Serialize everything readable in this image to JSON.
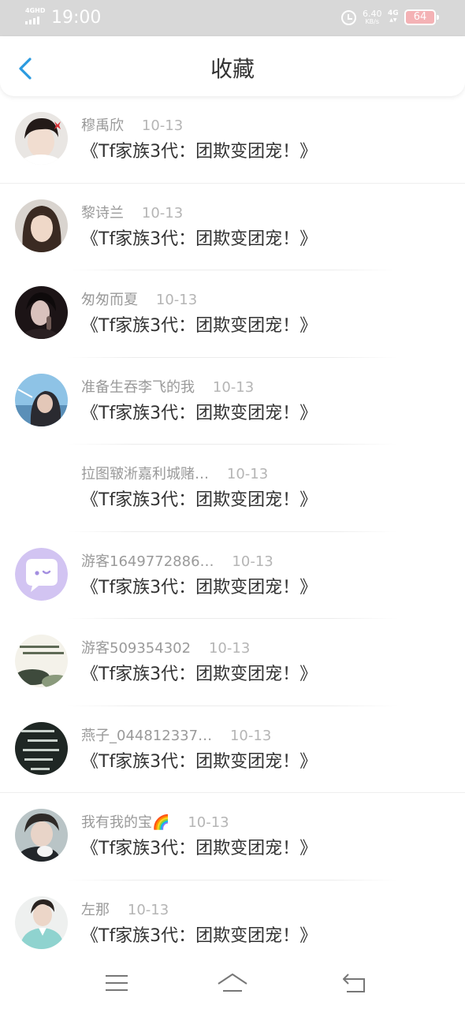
{
  "status_bar": {
    "network": "4GHD",
    "time": "19:00",
    "speed_value": "6.40",
    "speed_unit": "KB/s",
    "mobile_data": "4G",
    "battery": "64"
  },
  "header": {
    "title": "收藏",
    "back_icon": "chevron-left-icon",
    "accent_color": "#2a9ae0"
  },
  "items": [
    {
      "name": "穆禹欣",
      "date": "10-13",
      "title": "《Tf家族3代：团欺变团宠！》"
    },
    {
      "name": "黎诗兰",
      "date": "10-13",
      "title": "《Tf家族3代：团欺变团宠！》"
    },
    {
      "name": "匆匆而夏",
      "date": "10-13",
      "title": "《Tf家族3代：团欺变团宠！》"
    },
    {
      "name": "准备生吞李飞的我",
      "date": "10-13",
      "title": "《Tf家族3代：团欺变团宠！》"
    },
    {
      "name": "拉图皲淅嘉利城赌…",
      "date": "10-13",
      "title": "《Tf家族3代：团欺变团宠！》"
    },
    {
      "name": "游客1649772886…",
      "date": "10-13",
      "title": "《Tf家族3代：团欺变团宠！》"
    },
    {
      "name": "游客509354302",
      "date": "10-13",
      "title": "《Tf家族3代：团欺变团宠！》"
    },
    {
      "name": "燕子_044812337…",
      "date": "10-13",
      "title": "《Tf家族3代：团欺变团宠！》"
    },
    {
      "name": "我有我的宝🌈",
      "date": "10-13",
      "title": "《Tf家族3代：团欺变团宠！》"
    },
    {
      "name": "左那",
      "date": "10-13",
      "title": "《Tf家族3代：团欺变团宠！》"
    }
  ],
  "bottom_nav": {
    "menu_icon": "menu-icon",
    "home_icon": "home-icon",
    "back_icon": "return-icon"
  }
}
